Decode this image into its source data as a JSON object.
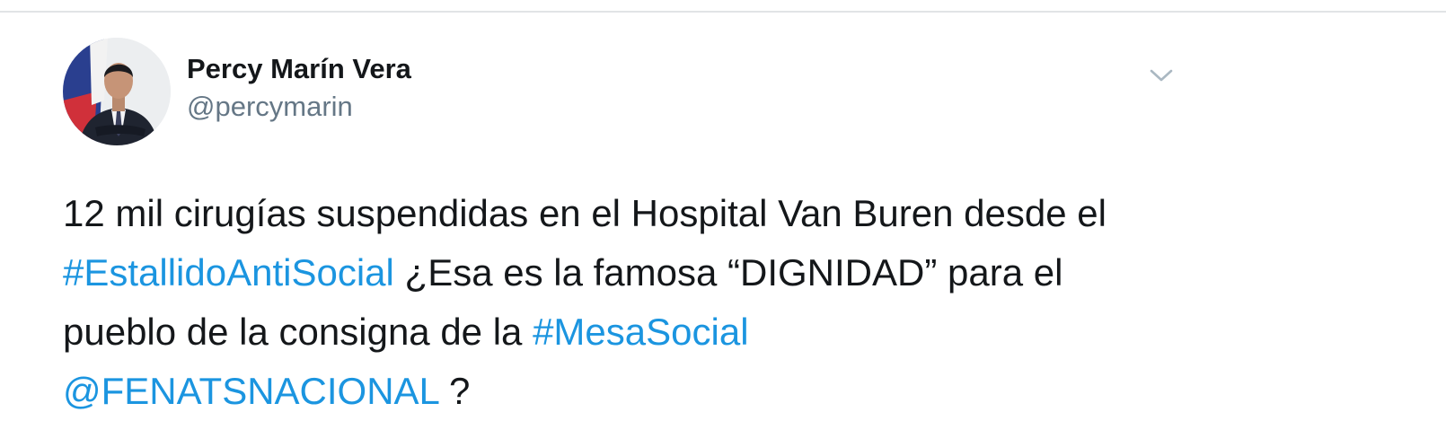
{
  "author": {
    "display_name": "Percy Marín Vera",
    "handle": "@percymarin",
    "avatar_icon": "profile-photo"
  },
  "menu": {
    "icon": "chevron-down-icon"
  },
  "tweet": {
    "line1": {
      "text": "12 mil cirugías suspendidas en el Hospital Van Buren  desde el"
    },
    "line2": {
      "hashtag": "#EstallidoAntiSocial",
      "text": " ¿Esa es la famosa “DIGNIDAD” para el"
    },
    "line3": {
      "text": "pueblo de la consigna de la ",
      "hashtag": "#MesaSocial"
    },
    "line4": {
      "mention": "@FENATSNACIONAL",
      "text": " ?"
    }
  },
  "colors": {
    "link": "#1b95e0",
    "text": "#14171a",
    "secondary": "#657786",
    "divider": "#e1e4e6"
  }
}
